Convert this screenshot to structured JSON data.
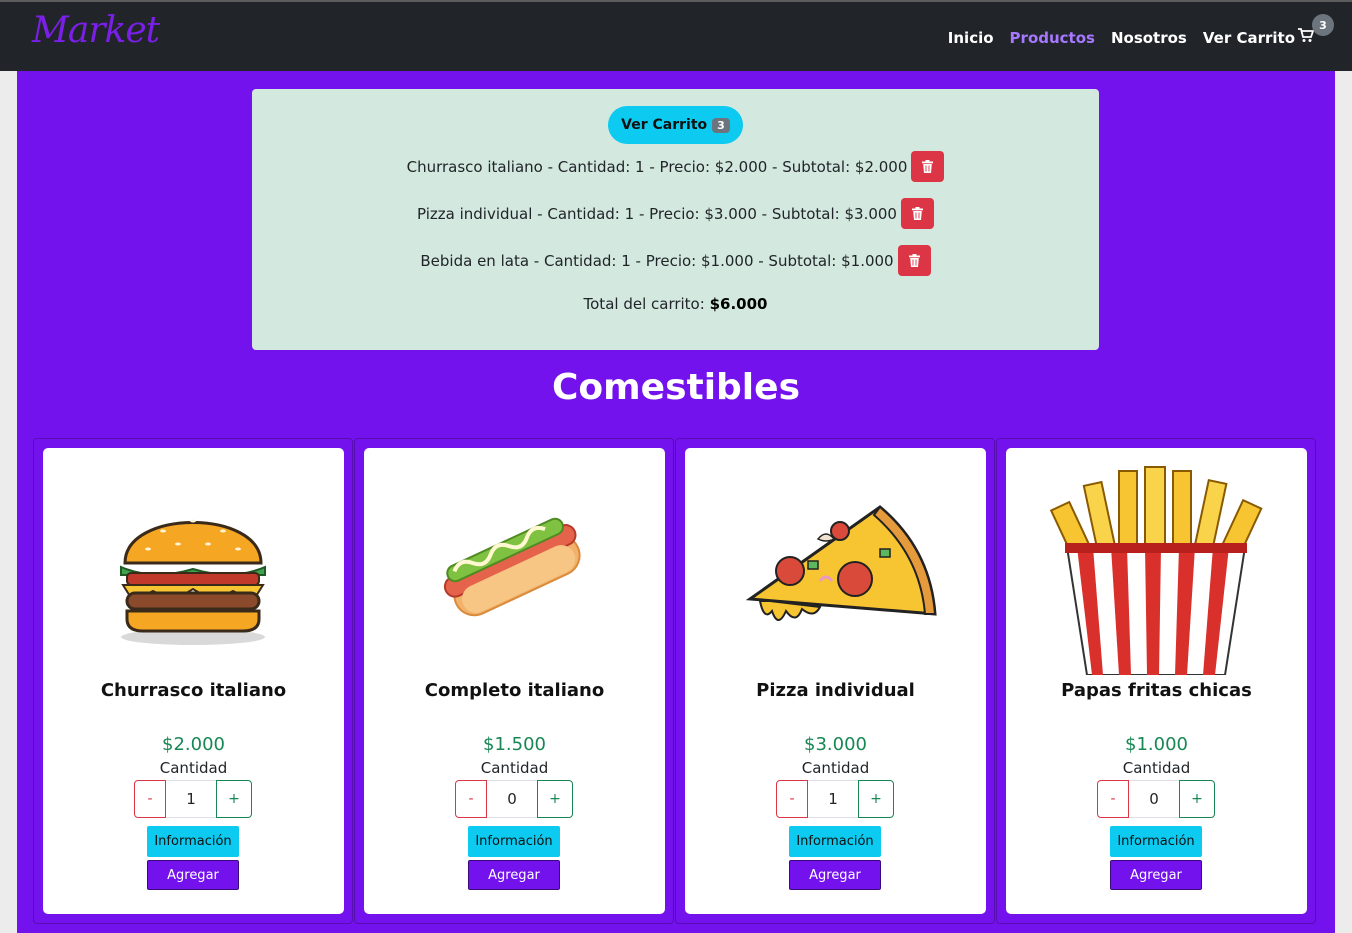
{
  "navbar": {
    "brand": "Market",
    "links": [
      "Inicio",
      "Productos",
      "Nosotros"
    ],
    "cart_label": "Ver Carrito",
    "cart_count": "3"
  },
  "cart": {
    "button_label": "Ver Carrito",
    "count": "3",
    "items": [
      "Churrasco italiano - Cantidad: 1 - Precio: $2.000 - Subtotal: $2.000",
      "Pizza individual - Cantidad: 1 - Precio: $3.000 - Subtotal: $3.000",
      "Bebida en lata - Cantidad: 1 - Precio: $1.000 - Subtotal: $1.000"
    ],
    "total_label": "Total del carrito:",
    "total_value": "$6.000"
  },
  "section": {
    "title": "Comestibles"
  },
  "products": [
    {
      "name": "Churrasco italiano",
      "price": "$2.000",
      "qty_label": "Cantidad",
      "qty": "1",
      "minus": "-",
      "plus": "+",
      "info": "Información",
      "add": "Agregar"
    },
    {
      "name": "Completo italiano",
      "price": "$1.500",
      "qty_label": "Cantidad",
      "qty": "0",
      "minus": "-",
      "plus": "+",
      "info": "Información",
      "add": "Agregar"
    },
    {
      "name": "Pizza individual",
      "price": "$3.000",
      "qty_label": "Cantidad",
      "qty": "1",
      "minus": "-",
      "plus": "+",
      "info": "Información",
      "add": "Agregar"
    },
    {
      "name": "Papas fritas chicas",
      "price": "$1.000",
      "qty_label": "Cantidad",
      "qty": "0",
      "minus": "-",
      "plus": "+",
      "info": "Información",
      "add": "Agregar"
    }
  ],
  "colors": {
    "primary": "#7412ee",
    "info": "#0dcaf0",
    "danger": "#dc3545",
    "success": "#198754",
    "navbar": "#212529",
    "cart_panel": "#d3e8df"
  },
  "icons": {
    "cart": "cart-icon",
    "delete": "trash-icon"
  }
}
